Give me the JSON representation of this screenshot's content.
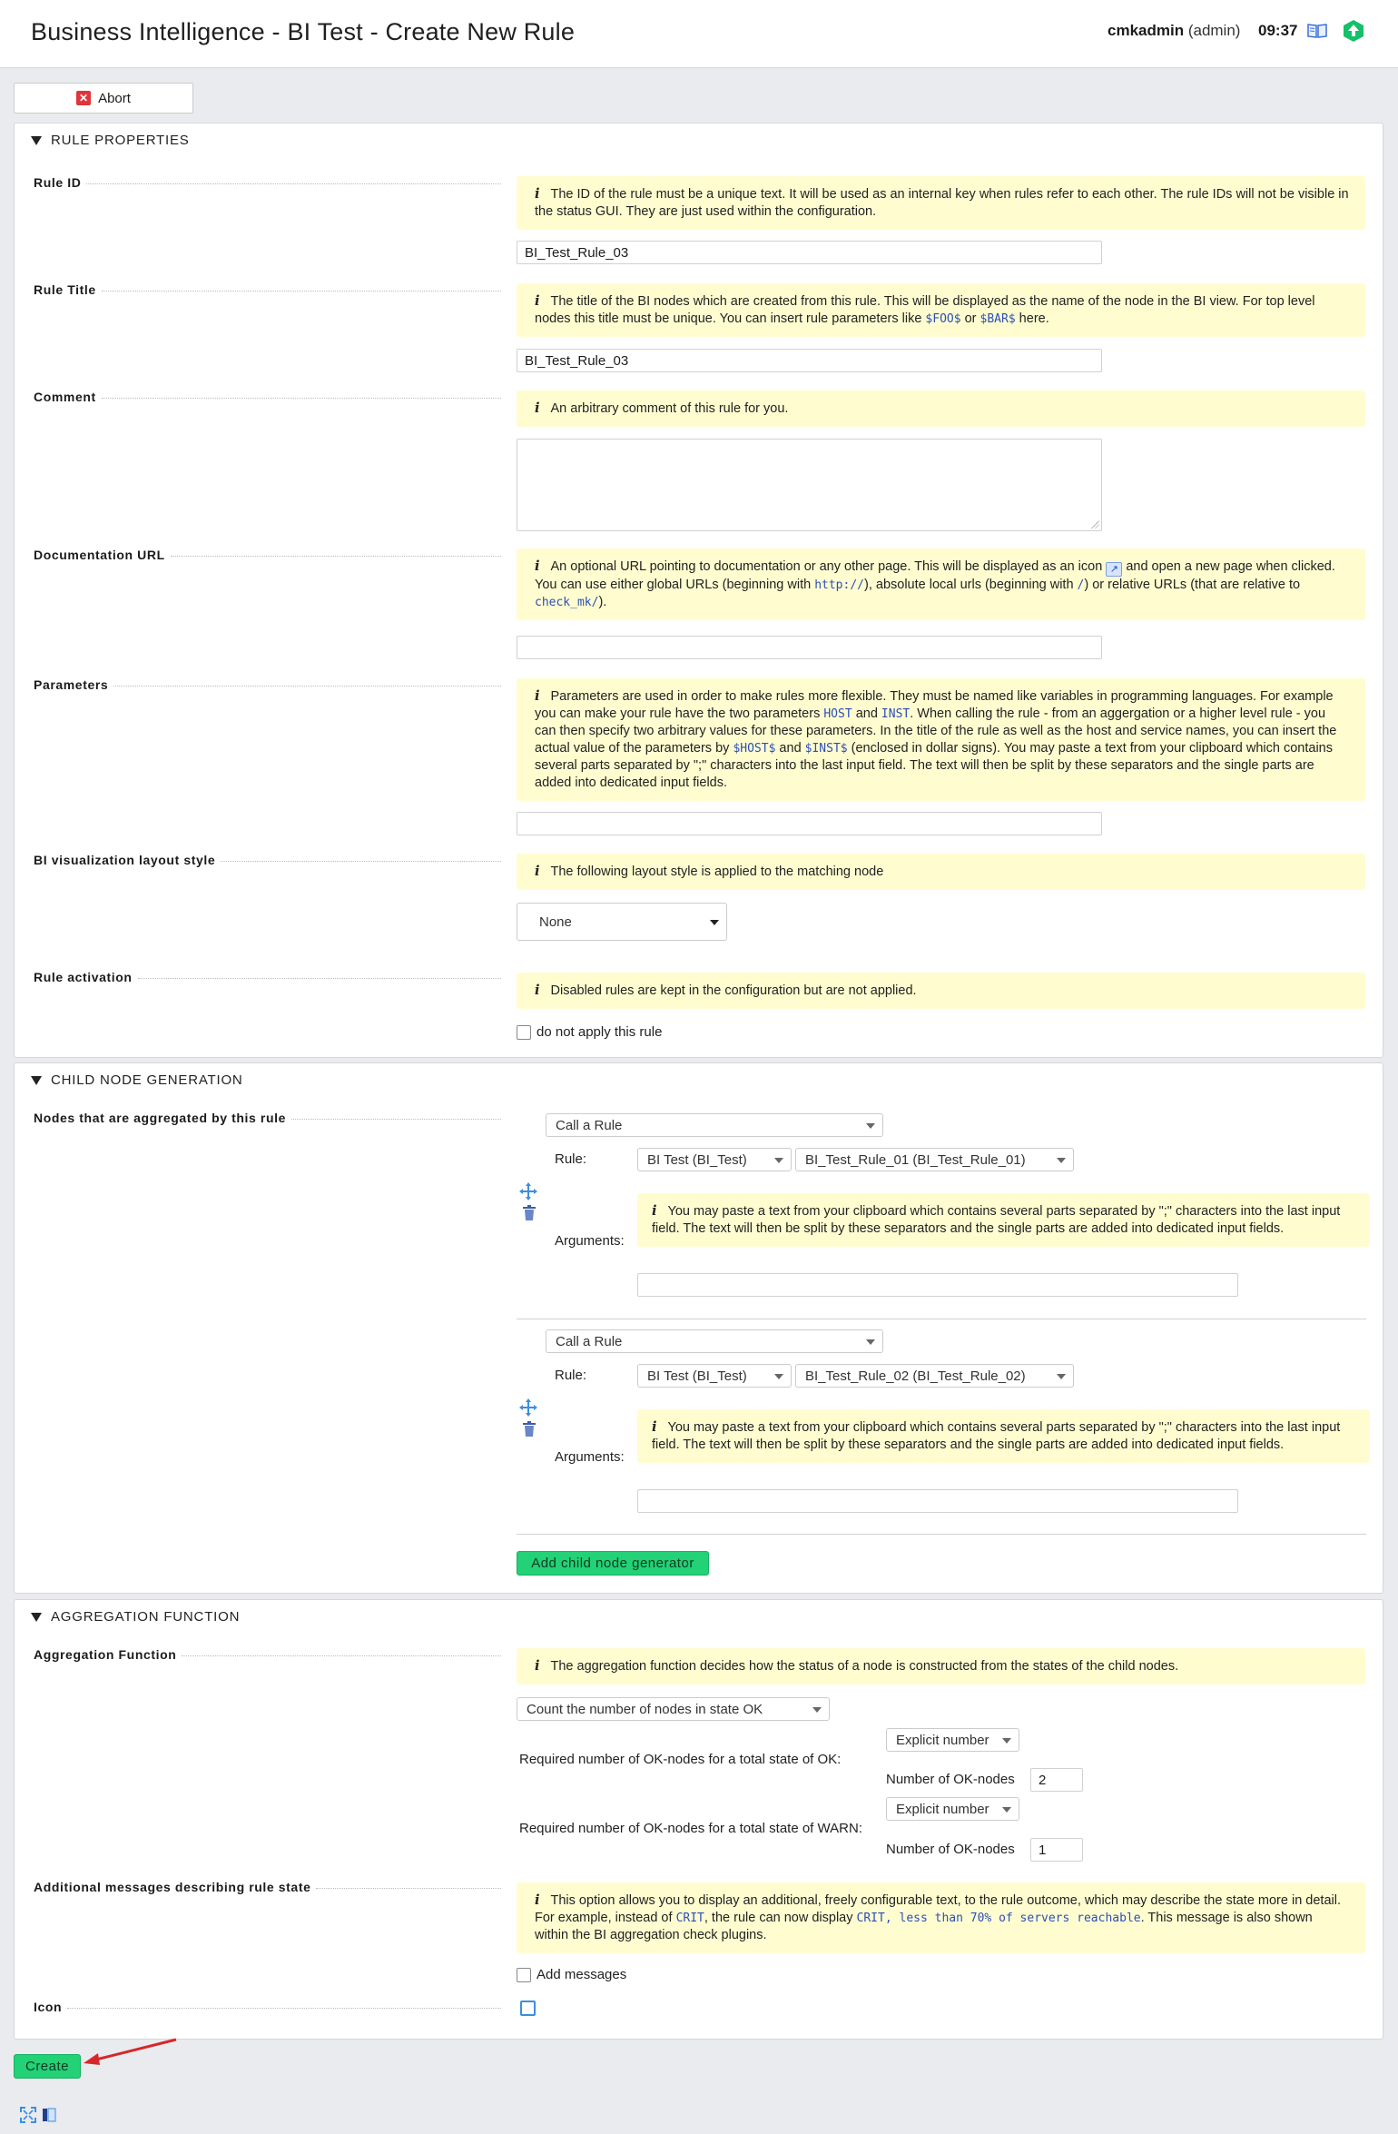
{
  "header": {
    "title": "Business Intelligence - BI Test - Create New Rule",
    "user": "cmkadmin",
    "role": "(admin)",
    "time": "09:37",
    "icons": [
      "book-icon",
      "update-icon"
    ]
  },
  "toolbar": {
    "abort_label": "Abort"
  },
  "rule_properties": {
    "heading": "RULE PROPERTIES",
    "rule_id": {
      "label": "Rule ID",
      "help": "The ID of the rule must be a unique text. It will be used as an internal key when rules refer to each other. The rule IDs will not be visible in the status GUI. They are just used within the configuration.",
      "value": "BI_Test_Rule_03"
    },
    "rule_title": {
      "label": "Rule Title",
      "help_pre": "The title of the BI nodes which are created from this rule. This will be displayed as the name of the node in the BI view. For top level nodes this title must be unique. You can insert rule parameters like ",
      "code1": "$FOO$",
      "help_mid": " or ",
      "code2": "$BAR$",
      "help_post": " here.",
      "value": "BI_Test_Rule_03"
    },
    "comment": {
      "label": "Comment",
      "help": "An arbitrary comment of this rule for you.",
      "value": ""
    },
    "doc_url": {
      "label": "Documentation URL",
      "help_1": "An optional URL pointing to documentation or any other page. This will be displayed as an icon ",
      "help_2": " and open a new page when clicked. You can use either global URLs (beginning with ",
      "code1": "http://",
      "help_3": "), absolute local urls (beginning with ",
      "code2": "/",
      "help_4": ") or relative URLs (that are relative to ",
      "code3": "check_mk/",
      "help_5": ").",
      "value": ""
    },
    "parameters": {
      "label": "Parameters",
      "help_1": "Parameters are used in order to make rules more flexible. They must be named like variables in programming languages. For example you can make your rule have the two parameters ",
      "code1": "HOST",
      "help_2": " and ",
      "code2": "INST",
      "help_3": ". When calling the rule - from an aggergation or a higher level rule - you can then specify two arbitrary values for these parameters. In the title of the rule as well as the host and service names, you can insert the actual value of the parameters by ",
      "code3": "$HOST$",
      "help_4": " and ",
      "code4": "$INST$",
      "help_5": " (enclosed in dollar signs). You may paste a text from your clipboard which contains several parts separated by \";\" characters into the last input field. The text will then be split by these separators and the single parts are added into dedicated input fields.",
      "value": ""
    },
    "layout_style": {
      "label": "BI visualization layout style",
      "help": "The following layout style is applied to the matching node",
      "selected": "None"
    },
    "activation": {
      "label": "Rule activation",
      "help": "Disabled rules are kept in the configuration but are not applied.",
      "checkbox_label": "do not apply this rule",
      "checked": false
    }
  },
  "child_nodes": {
    "heading": "CHILD NODE GENERATION",
    "label": "Nodes that are aggregated by this rule",
    "rule_label": "Rule:",
    "arguments_label": "Arguments:",
    "args_help": "You may paste a text from your clipboard which contains several parts separated by \";\" characters into the last input field. The text will then be split by these separators and the single parts are added into dedicated input fields.",
    "generators": [
      {
        "type": "Call a Rule",
        "pack": "BI Test (BI_Test)",
        "rule": "BI_Test_Rule_01 (BI_Test_Rule_01)",
        "argument": ""
      },
      {
        "type": "Call a Rule",
        "pack": "BI Test (BI_Test)",
        "rule": "BI_Test_Rule_02 (BI_Test_Rule_02)",
        "argument": ""
      }
    ],
    "add_label": "Add child node generator"
  },
  "aggregation": {
    "heading": "AGGREGATION FUNCTION",
    "func_label": "Aggregation Function",
    "func_help": "The aggregation function decides how the status of a node is constructed from the states of the child nodes.",
    "func_selected": "Count the number of nodes in state OK",
    "ok_label": "Required number of OK-nodes for a total state of OK:",
    "warn_label": "Required number of OK-nodes for a total state of WARN:",
    "mode_selected": "Explicit number",
    "num_label": "Number of OK-nodes",
    "ok_value": "2",
    "warn_value": "1",
    "msg_label": "Additional messages describing rule state",
    "msg_help_1": "This option allows you to display an additional, freely configurable text, to the rule outcome, which may describe the state more in detail. For example, instead of ",
    "msg_code1": "CRIT",
    "msg_help_2": ", the rule can now display ",
    "msg_code2": "CRIT, less than 70% of servers reachable",
    "msg_help_3": ". This message is also shown within the BI aggregation check plugins.",
    "add_messages_label": "Add messages",
    "icon_label": "Icon"
  },
  "footer": {
    "create_label": "Create"
  },
  "colors": {
    "help_bg": "#fffdd0",
    "accent_green": "#23d176",
    "code_blue": "#2b4fb8",
    "arrow_red": "#d62828"
  }
}
